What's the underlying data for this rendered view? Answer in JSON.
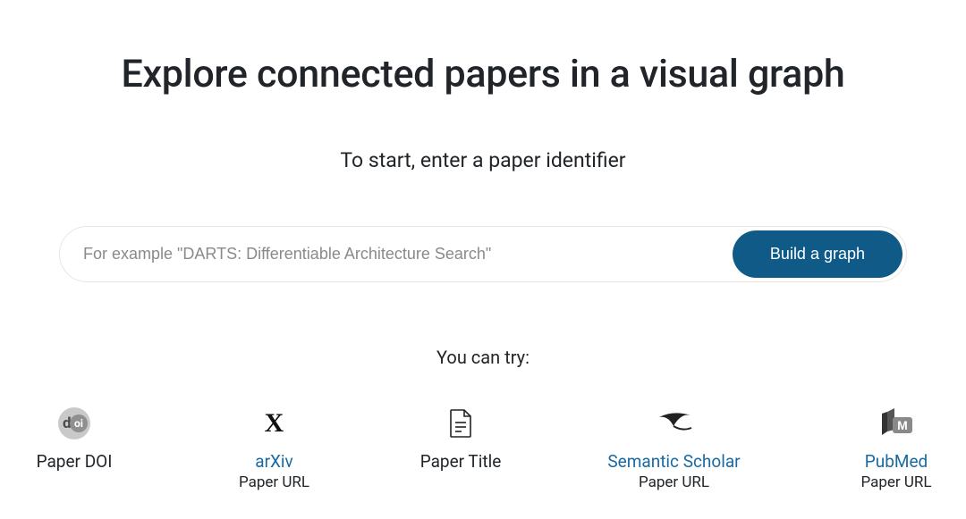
{
  "hero": {
    "title": "Explore connected papers in a visual graph",
    "subtitle": "To start, enter a paper identifier"
  },
  "search": {
    "placeholder": "For example \"DARTS: Differentiable Architecture Search\"",
    "button_label": "Build a graph"
  },
  "suggestions": {
    "label": "You can try:",
    "options": [
      {
        "title": "Paper DOI",
        "subtitle": "",
        "link": false,
        "icon": "doi-icon"
      },
      {
        "title": "arXiv",
        "subtitle": "Paper URL",
        "link": true,
        "icon": "arxiv-icon"
      },
      {
        "title": "Paper Title",
        "subtitle": "",
        "link": false,
        "icon": "document-icon"
      },
      {
        "title": "Semantic Scholar",
        "subtitle": "Paper URL",
        "link": true,
        "icon": "semantic-scholar-icon"
      },
      {
        "title": "PubMed",
        "subtitle": "Paper URL",
        "link": true,
        "icon": "pubmed-icon"
      }
    ]
  }
}
